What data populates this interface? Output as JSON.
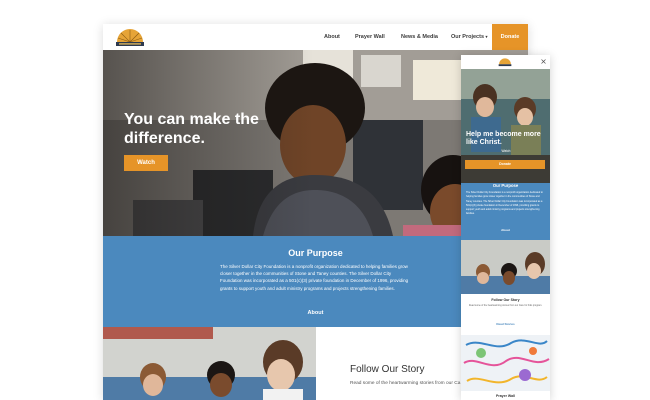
{
  "colors": {
    "accent": "#e69428",
    "purpose_blue": "#4b89be",
    "text_dark": "#333333"
  },
  "desktop": {
    "logo_alt": "Silver Dollar City Foundation",
    "nav": {
      "items": [
        "About",
        "Prayer Wall",
        "News & Media",
        "Our Projects"
      ],
      "projects_dropdown_icon": "chevron-down-icon",
      "donate": "Donate"
    },
    "hero": {
      "title": "You can make the difference.",
      "button": "Watch"
    },
    "purpose": {
      "title": "Our Purpose",
      "text": "The Silver Dollar City Foundation is a nonprofit organization dedicated to helping families grow closer together in the communities of Stone and Taney counties. The Silver Dollar City Foundation was incorporated as a 501(c)(3) private foundation in December of 1996, providing grants to support youth and adult ministry programs and projects strengthening families.",
      "link": "About"
    },
    "story": {
      "title": "Follow Our Story",
      "text": "Read some of the heartwarming stories from our Ca program."
    }
  },
  "mobile": {
    "menu_icon": "close-icon",
    "hero": {
      "title": "Help me become more like Christ.",
      "subtitle": "Watch",
      "button": "Donate"
    },
    "purpose": {
      "title": "Our Purpose",
      "text": "The Silver Dollar City Foundation is a nonprofit organization dedicated to helping families grow closer together in the communities of Stone and Taney counties. The Silver Dollar City Foundation was incorporated as a 501(c)(3) private foundation in December of 1996, providing grants to support youth and adult ministry programs and projects strengthening families.",
      "link": "About"
    },
    "story": {
      "title": "Follow Our Story",
      "text": "Read some of the heartwarming stories from our Care for Kids program.",
      "link": "Read Stories"
    },
    "prayer": {
      "title": "Prayer Wall"
    }
  }
}
